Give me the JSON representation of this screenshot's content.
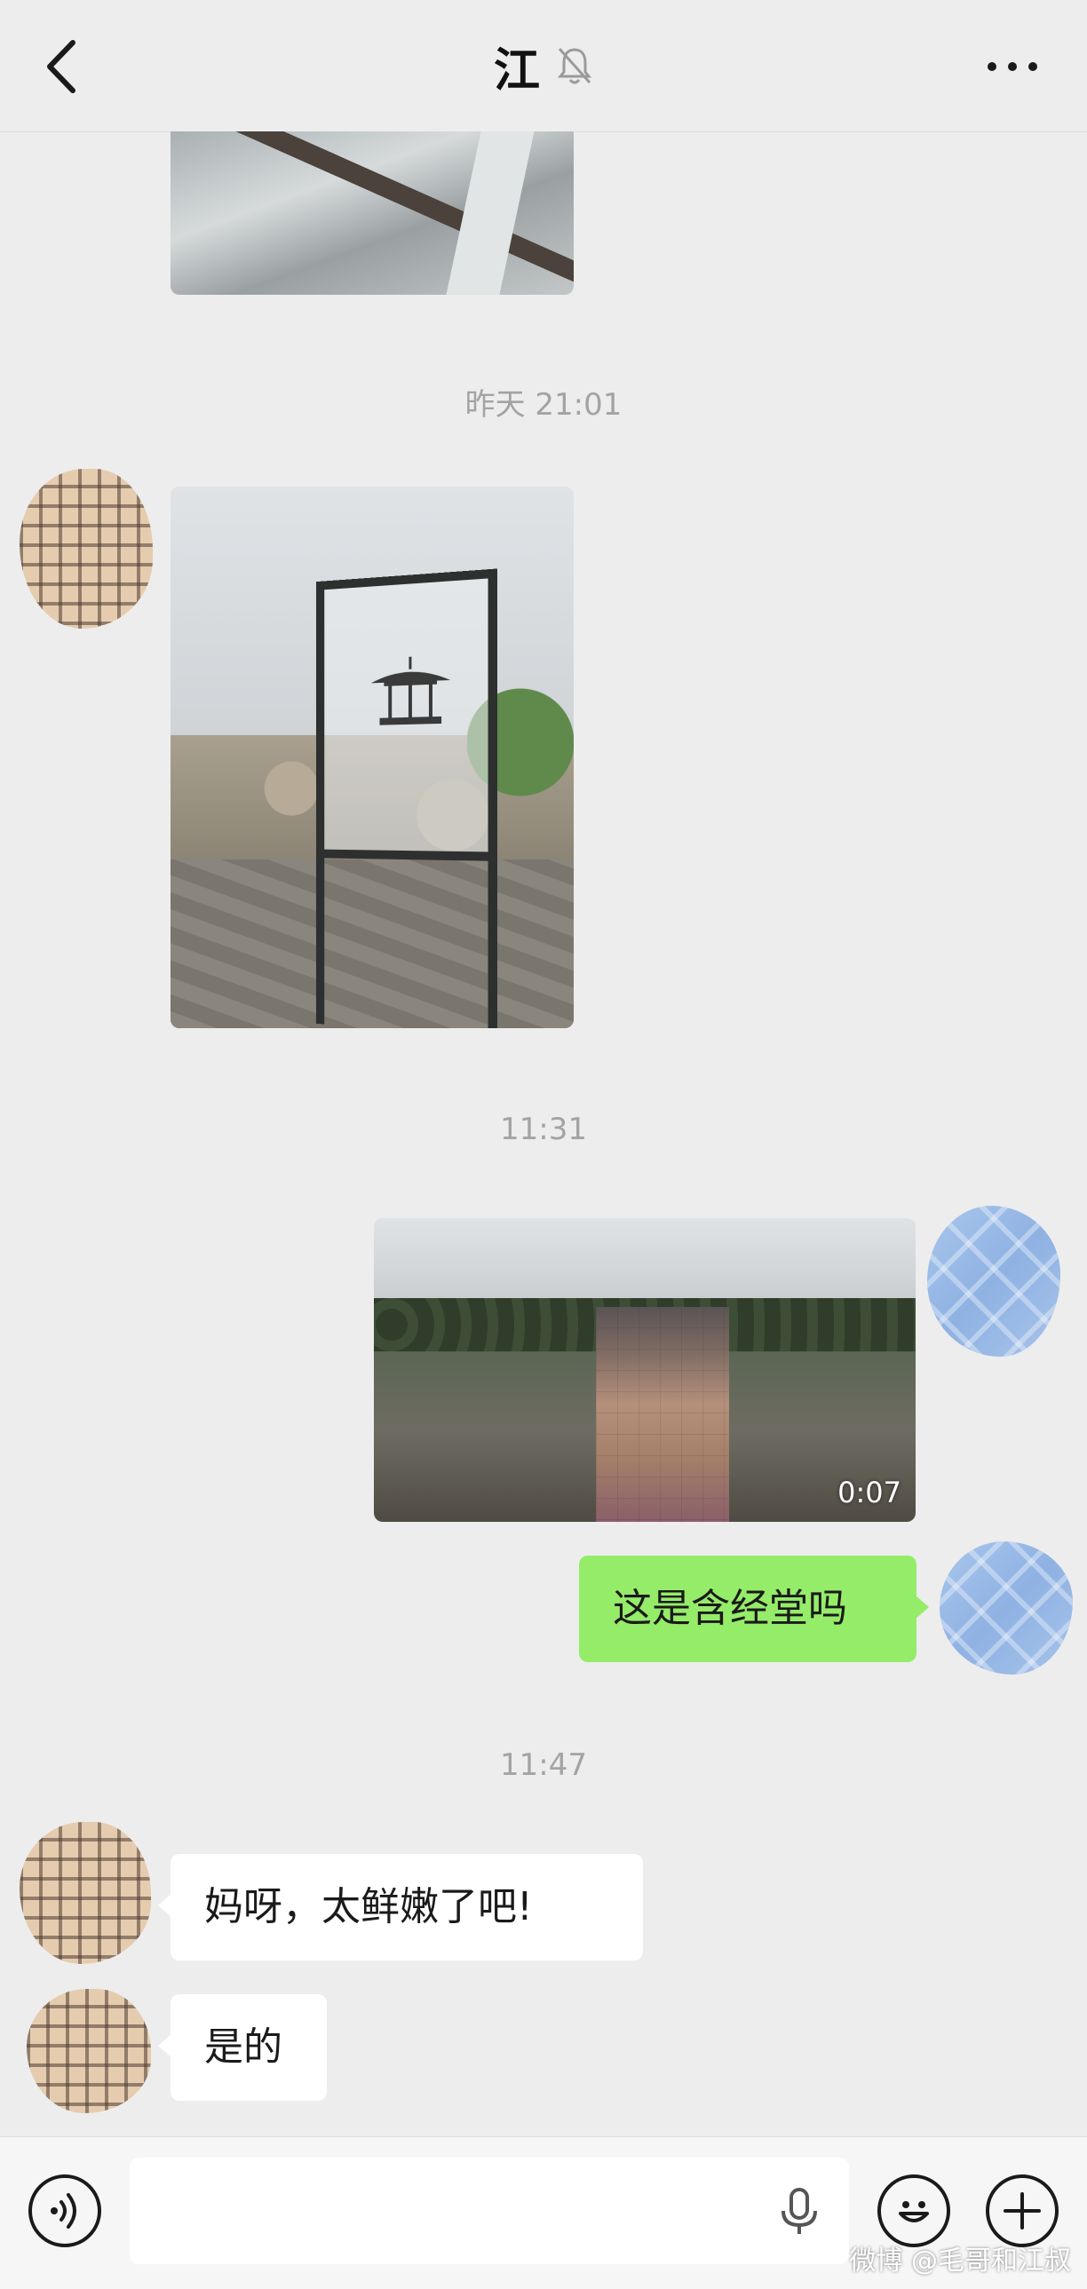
{
  "header": {
    "title": "江",
    "icons": {
      "back": "back-chevron-icon",
      "mute": "bell-muted-icon",
      "more": "more-dots-icon"
    }
  },
  "messages": {
    "timestamp_1": "昨天 21:01",
    "timestamp_2": "11:31",
    "timestamp_3": "11:47",
    "video_duration": "0:07",
    "sent_text": "这是含经堂吗",
    "reply_1": "妈呀，太鲜嫩了吧!",
    "reply_2": "是的"
  },
  "input_bar": {
    "text_value": "",
    "icons": {
      "voice": "voice-icon",
      "mic": "microphone-icon",
      "emoji": "emoji-icon",
      "plus": "plus-icon"
    }
  },
  "watermark": "微博 @毛哥和江叔",
  "colors": {
    "background": "#ededed",
    "sent_bubble": "#95ec69",
    "received_bubble": "#ffffff",
    "timestamp": "#a3a3a3"
  }
}
